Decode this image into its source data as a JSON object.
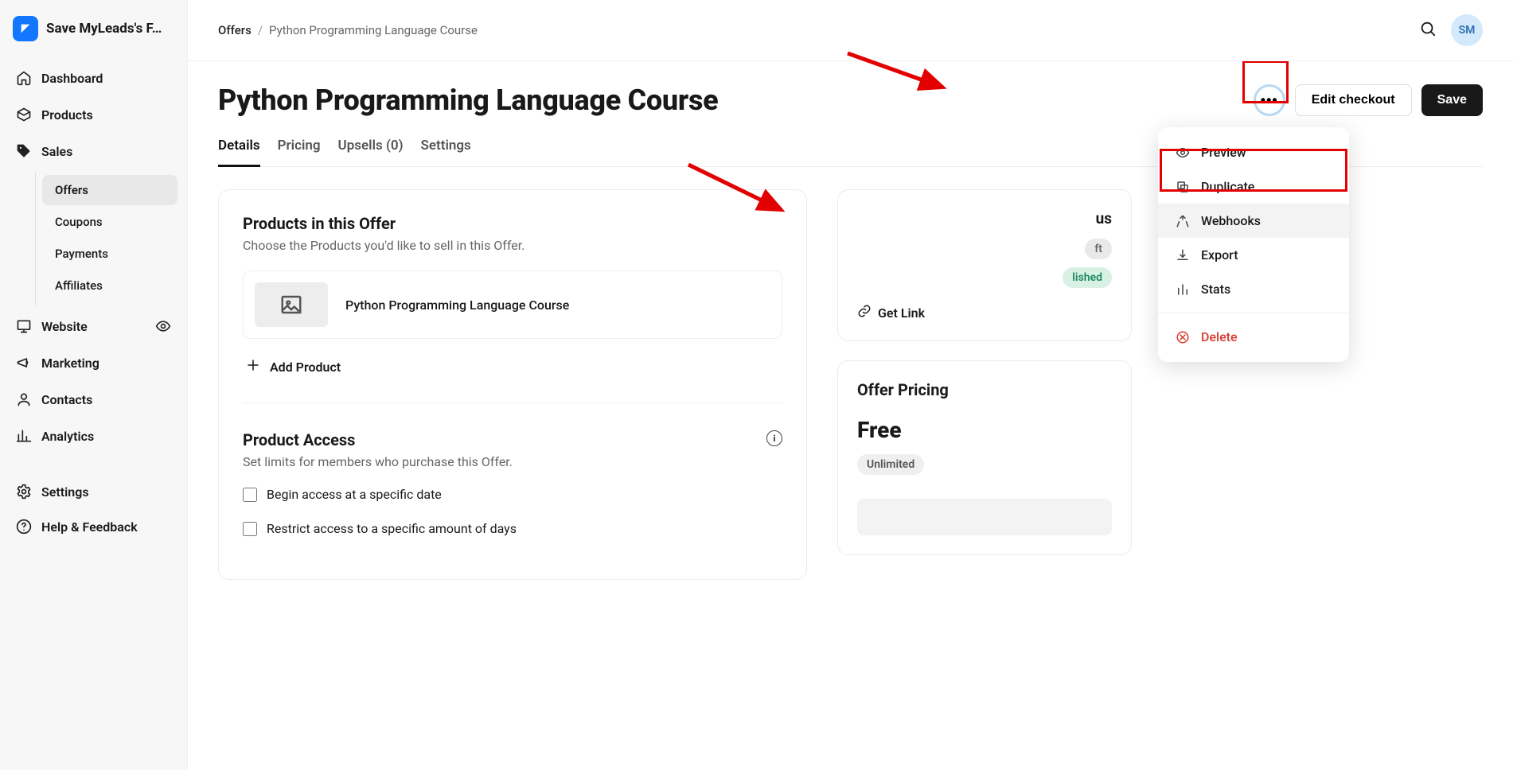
{
  "brand": {
    "name": "Save MyLeads's F…",
    "initials": "SM"
  },
  "sidebar": {
    "items": [
      {
        "label": "Dashboard"
      },
      {
        "label": "Products"
      },
      {
        "label": "Sales"
      },
      {
        "label": "Website"
      },
      {
        "label": "Marketing"
      },
      {
        "label": "Contacts"
      },
      {
        "label": "Analytics"
      }
    ],
    "sales_sub": [
      {
        "label": "Offers"
      },
      {
        "label": "Coupons"
      },
      {
        "label": "Payments"
      },
      {
        "label": "Affiliates"
      }
    ],
    "bottom": [
      {
        "label": "Settings"
      },
      {
        "label": "Help & Feedback"
      }
    ]
  },
  "breadcrumb": {
    "root": "Offers",
    "current": "Python Programming Language Course"
  },
  "header": {
    "title": "Python Programming Language Course",
    "edit_checkout": "Edit checkout",
    "save": "Save"
  },
  "tabs": [
    {
      "label": "Details"
    },
    {
      "label": "Pricing"
    },
    {
      "label": "Upsells (0)"
    },
    {
      "label": "Settings"
    }
  ],
  "products_section": {
    "title": "Products in this Offer",
    "subtitle": "Choose the Products you'd like to sell in this Offer.",
    "product": "Python Programming Language Course",
    "add": "Add Product"
  },
  "access_section": {
    "title": "Product Access",
    "subtitle": "Set limits for members who purchase this Offer.",
    "opt1": "Begin access at a specific date",
    "opt2": "Restrict access to a specific amount of days"
  },
  "status": {
    "heading": "us",
    "draft": "ft",
    "published": "lished",
    "getlink": "Get Link"
  },
  "pricing": {
    "heading": "Offer Pricing",
    "value": "Free",
    "limit": "Unlimited"
  },
  "dropdown": {
    "preview": "Preview",
    "duplicate": "Duplicate",
    "webhooks": "Webhooks",
    "export": "Export",
    "stats": "Stats",
    "delete": "Delete"
  }
}
